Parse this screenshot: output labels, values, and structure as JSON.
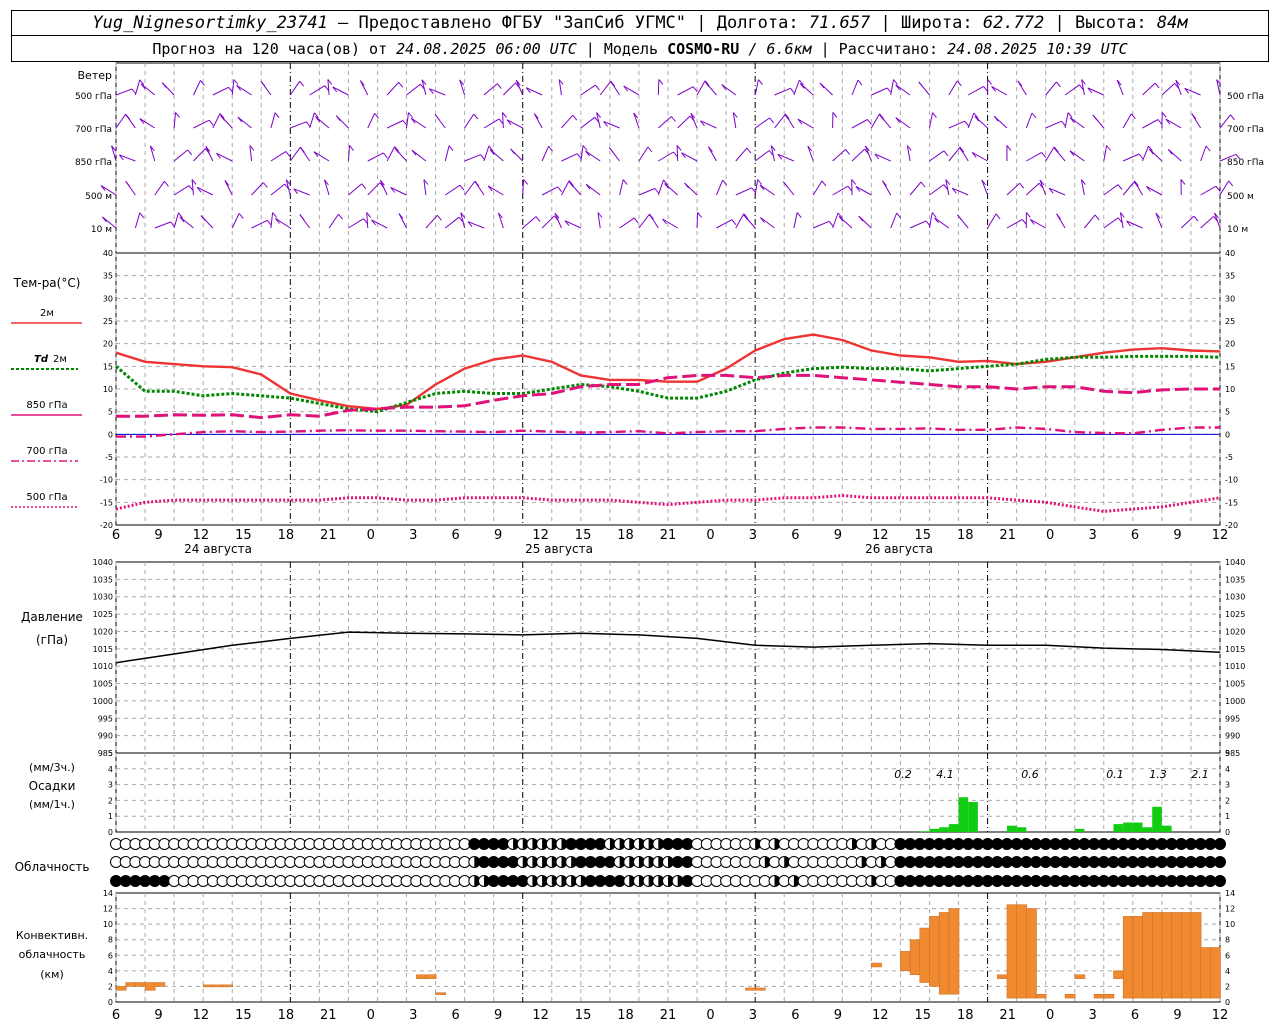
{
  "header": {
    "station": "Yug_Nignesortimky_23741",
    "provider": " — Предоставлено ФГБУ \"ЗапСиб УГМС\" | Долгота: ",
    "lon": "71.657",
    "lat_label": " | Широта: ",
    "lat": "62.772",
    "alt_label": " | Высота: ",
    "alt": "84м",
    "fc_label": "Прогноз на 120 часа(ов) от ",
    "fc_time": "24.08.2025 06:00 UTC",
    "model_label": " | Модель ",
    "model": "COSMO-RU",
    "res": " / 6.6км",
    "calc_label": " | Рассчитано: ",
    "calc_time": "24.08.2025 10:39 UTC"
  },
  "colors": {
    "temp2m": "#ee3333",
    "td2m": "#008800",
    "p850": "#e0127a",
    "p700": "#e0127a",
    "p500": "#e0127a",
    "barb": "#7b00c8",
    "precip": "#11cc11",
    "conv": "#f08a30",
    "grid": "#aaaaaa"
  },
  "labels": {
    "wind": "Ветер",
    "wind_levels": [
      "500 гПа",
      "700 гПа",
      "850 гПа",
      "500 м",
      "10  м"
    ],
    "temp": "Тем-ра(°C)",
    "t2m": "2м",
    "td_a": "Td",
    "td_b": "2м",
    "l850": "850 гПа",
    "l700": "700 гПа",
    "l500": "500 гПа",
    "pressure_a": "Давление",
    "pressure_b": "(гПа)",
    "precip_a": "(мм/3ч.)",
    "precip_b": "Осадки",
    "precip_c": "(мм/1ч.)",
    "cloud": "Облачность",
    "conv_a": "Конвективн.",
    "conv_b": "облачность",
    "conv_c": "(км)"
  },
  "time_ticks": [
    "6",
    "9",
    "12",
    "15",
    "18",
    "21",
    "0",
    "3",
    "6",
    "9",
    "12",
    "15",
    "18",
    "21",
    "0",
    "3",
    "6",
    "9",
    "12",
    "15",
    "18",
    "21",
    "0",
    "3",
    "6",
    "9",
    "12"
  ],
  "dates": [
    "24 августа",
    "25 августа",
    "26 августа"
  ],
  "precip_totals": [
    "0.2",
    "4.1",
    "0.6",
    "0.1",
    "1.3",
    "2.1"
  ],
  "chart_data": [
    {
      "type": "line",
      "title": "Тем-ра(°C)",
      "x_hours": [
        0,
        3,
        6,
        9,
        12,
        15,
        18,
        21,
        24,
        27,
        30,
        33,
        36,
        39,
        42,
        45,
        48,
        51,
        54,
        57,
        60,
        63,
        66,
        69,
        72,
        75,
        78,
        81,
        84,
        87,
        90,
        93,
        96,
        99,
        102,
        105,
        108,
        111,
        114
      ],
      "ylim": [
        -20,
        40
      ],
      "series": [
        {
          "name": "2м",
          "values": [
            18,
            16,
            15.5,
            15,
            14.8,
            13.2,
            9,
            7.5,
            6.2,
            5.6,
            6.5,
            11,
            14.5,
            16.5,
            17.4,
            16,
            13,
            12,
            12,
            11.6,
            11.6,
            14.5,
            18.5,
            21,
            22,
            20.8,
            18.5,
            17.4,
            17,
            16,
            16.2,
            15.5,
            16,
            17,
            18,
            18.7,
            19,
            18.5,
            18.3
          ]
        },
        {
          "name": "Td 2м",
          "values": [
            15,
            9.5,
            9.5,
            8.5,
            9,
            8.5,
            8,
            6.8,
            5.6,
            5,
            7,
            9,
            9.5,
            9,
            9,
            10,
            11,
            10.5,
            9.5,
            8,
            8,
            9.5,
            12,
            13.5,
            14.5,
            14.8,
            14.5,
            14.5,
            14,
            14.5,
            15,
            15.5,
            16.5,
            17,
            17,
            17.2,
            17.2,
            17.2,
            17
          ]
        },
        {
          "name": "850 гПа",
          "values": [
            4,
            4,
            4.3,
            4.2,
            4.3,
            3.7,
            4.3,
            4,
            5.3,
            5.6,
            6,
            6,
            6.3,
            7.5,
            8.5,
            9,
            10.5,
            11,
            11,
            12.5,
            13,
            13,
            12.5,
            13,
            13,
            12.5,
            12,
            11.5,
            11,
            10.5,
            10.5,
            10,
            10.5,
            10.5,
            9.5,
            9.2,
            9.8,
            10,
            10
          ]
        },
        {
          "name": "700 гПа",
          "values": [
            -0.5,
            -0.5,
            0,
            0.5,
            0.7,
            0.5,
            0.6,
            0.8,
            0.9,
            0.8,
            0.8,
            0.7,
            0.6,
            0.5,
            0.8,
            0.6,
            0.4,
            0.5,
            0.7,
            0.2,
            0.5,
            0.7,
            0.7,
            1.2,
            1.5,
            1.5,
            1.2,
            1.2,
            1.3,
            1,
            1,
            1.5,
            1.2,
            0.5,
            0.3,
            0.2,
            1,
            1.5,
            1.5
          ]
        },
        {
          "name": "500 гПа",
          "values": [
            -16.5,
            -15,
            -14.5,
            -14.5,
            -14.5,
            -14.5,
            -14.5,
            -14.5,
            -14,
            -14,
            -14.5,
            -14.5,
            -14,
            -14,
            -14,
            -14.5,
            -14.5,
            -14.5,
            -15,
            -15.5,
            -15,
            -14.5,
            -14.5,
            -14,
            -14,
            -13.5,
            -14,
            -14,
            -14,
            -14,
            -14,
            -14.5,
            -15,
            -16,
            -17,
            -16.5,
            -16,
            -15,
            -14
          ]
        }
      ]
    },
    {
      "type": "line",
      "title": "Давление",
      "ylabel": "(гПа)",
      "ylim": [
        985,
        1040
      ],
      "x_hours": [
        0,
        6,
        12,
        18,
        24,
        30,
        36,
        42,
        48,
        54,
        60,
        66,
        72,
        78,
        84,
        90,
        96,
        102,
        108,
        114
      ],
      "series": [
        {
          "name": "",
          "values": [
            1011,
            1013.5,
            1016,
            1018,
            1019.8,
            1019.5,
            1019.3,
            1019,
            1019.5,
            1019,
            1018,
            1016,
            1015.5,
            1016,
            1016.5,
            1016,
            1016,
            1015.2,
            1014.8,
            1014
          ]
        }
      ]
    },
    {
      "type": "bar",
      "title": "Осадки",
      "ylim": [
        0,
        5
      ],
      "x_hours": [
        83,
        84,
        85,
        86,
        87,
        88,
        92,
        93,
        99,
        103,
        104,
        105,
        106,
        107,
        108
      ],
      "values": [
        0.05,
        0.2,
        0.3,
        0.5,
        2.2,
        1.9,
        0.4,
        0.3,
        0.2,
        0.5,
        0.6,
        0.6,
        0.3,
        1.6,
        0.4
      ]
    },
    {
      "type": "bar",
      "title": "Конвективн. облачность (км)",
      "ylim": [
        0,
        13
      ],
      "bars_km": [
        [
          1,
          1.5,
          2
        ],
        [
          2,
          2,
          2.5
        ],
        [
          3,
          2,
          2.5
        ],
        [
          4,
          1.5,
          2.5
        ],
        [
          5,
          2,
          2.5
        ],
        [
          10,
          2,
          2.2
        ],
        [
          11,
          2,
          2.2
        ],
        [
          12,
          2,
          2.2
        ],
        [
          32,
          3,
          3.5
        ],
        [
          33,
          3,
          3.5
        ],
        [
          34,
          1,
          1.2
        ],
        [
          66,
          1.5,
          1.8
        ],
        [
          67,
          1.5,
          1.8
        ],
        [
          79,
          4.5,
          5
        ],
        [
          82,
          4,
          6.5
        ],
        [
          83,
          3.5,
          8
        ],
        [
          84,
          2.5,
          9.5
        ],
        [
          85,
          2,
          11
        ],
        [
          86,
          1,
          11.5
        ],
        [
          87,
          1,
          12
        ],
        [
          92,
          3,
          3.5
        ],
        [
          93,
          0.5,
          12.5
        ],
        [
          94,
          0.5,
          12.5
        ],
        [
          95,
          0.5,
          12
        ],
        [
          96,
          0.5,
          1
        ],
        [
          99,
          0.5,
          1
        ],
        [
          100,
          3,
          3.5
        ],
        [
          102,
          0.5,
          1
        ],
        [
          103,
          0.5,
          1
        ],
        [
          104,
          3,
          4
        ],
        [
          105,
          0.5,
          11
        ],
        [
          106,
          0.5,
          11
        ],
        [
          107,
          0.5,
          11.5
        ],
        [
          108,
          0.5,
          11.5
        ],
        [
          109,
          0.5,
          11.5
        ],
        [
          110,
          0.5,
          11.5
        ],
        [
          111,
          0.5,
          11.5
        ],
        [
          112,
          0.5,
          11.5
        ],
        [
          113,
          0.5,
          7
        ],
        [
          114,
          0.5,
          7
        ]
      ]
    }
  ]
}
